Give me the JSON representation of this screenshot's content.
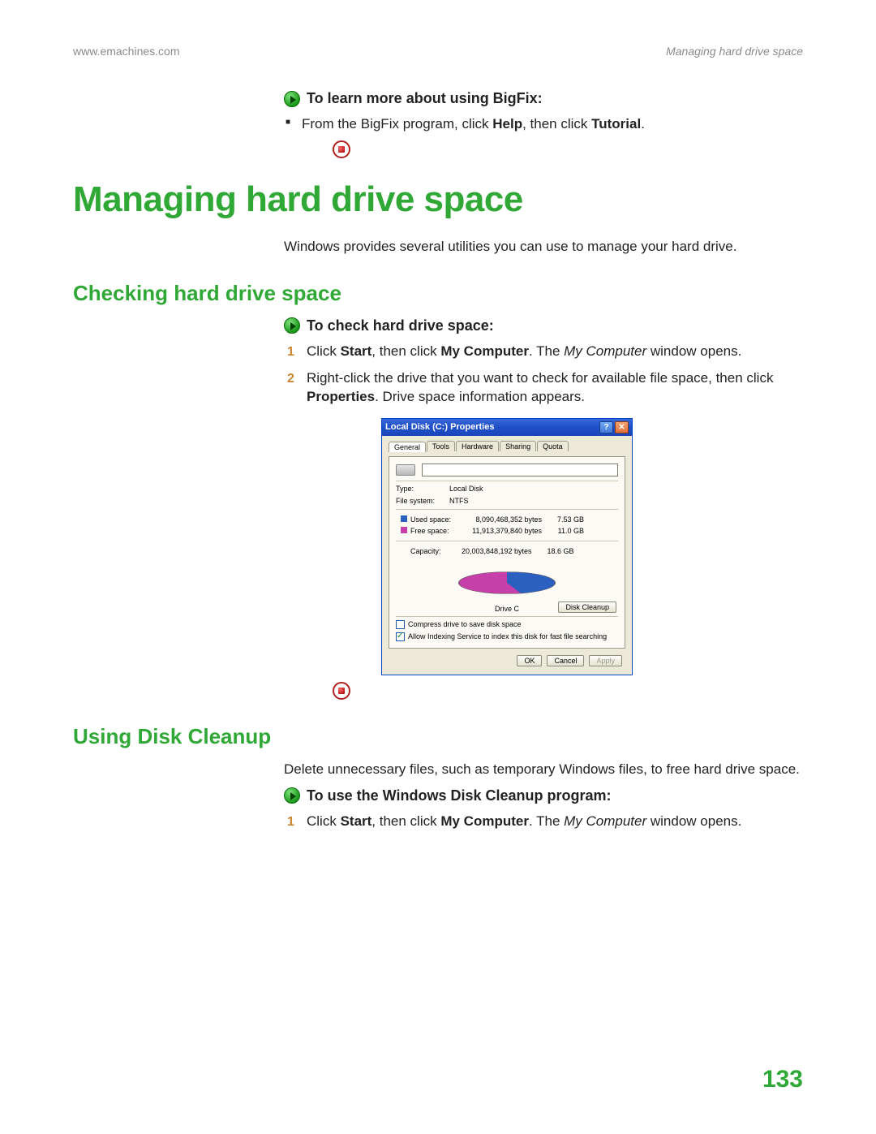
{
  "header": {
    "left": "www.emachines.com",
    "right": "Managing hard drive space"
  },
  "sec_bigfix": {
    "task_label": "To learn more about using BigFix:",
    "bullet1_pre": "From the BigFix program, click ",
    "bullet1_b1": "Help",
    "bullet1_mid": ", then click ",
    "bullet1_b2": "Tutorial",
    "bullet1_post": "."
  },
  "h1": "Managing hard drive space",
  "intro": "Windows provides several utilities you can use to manage your hard drive.",
  "h2_check": "Checking hard drive space",
  "task_check": "To check hard drive space:",
  "step_check_1": {
    "pre": "Click ",
    "b1": "Start",
    "mid1": ", then click ",
    "b2": "My Computer",
    "mid2": ". The ",
    "i1": "My Computer",
    "post": " window opens."
  },
  "step_check_2": {
    "pre": "Right-click the drive that you want to check for available file space, then click ",
    "b1": "Properties",
    "post": ". Drive space information appears."
  },
  "dialog": {
    "title": "Local Disk (C:) Properties",
    "tabs": [
      "General",
      "Tools",
      "Hardware",
      "Sharing",
      "Quota"
    ],
    "type_label": "Type:",
    "type_value": "Local Disk",
    "fs_label": "File system:",
    "fs_value": "NTFS",
    "used_label": "Used space:",
    "used_bytes": "8,090,468,352 bytes",
    "used_gb": "7.53 GB",
    "free_label": "Free space:",
    "free_bytes": "11,913,379,840 bytes",
    "free_gb": "11.0 GB",
    "cap_label": "Capacity:",
    "cap_bytes": "20,003,848,192 bytes",
    "cap_gb": "18.6 GB",
    "drive_label": "Drive C",
    "disk_cleanup": "Disk Cleanup",
    "compress": "Compress drive to save disk space",
    "indexing": "Allow Indexing Service to index this disk for fast file searching",
    "ok": "OK",
    "cancel": "Cancel",
    "apply": "Apply"
  },
  "h2_cleanup": "Using Disk Cleanup",
  "cleanup_intro": "Delete unnecessary files, such as temporary Windows files, to free hard drive space.",
  "task_cleanup": "To use the Windows Disk Cleanup program:",
  "step_cleanup_1": {
    "pre": "Click ",
    "b1": "Start",
    "mid1": ", then click ",
    "b2": "My Computer",
    "mid2": ". The ",
    "i1": "My Computer",
    "post": " window opens."
  },
  "page_number": "133"
}
